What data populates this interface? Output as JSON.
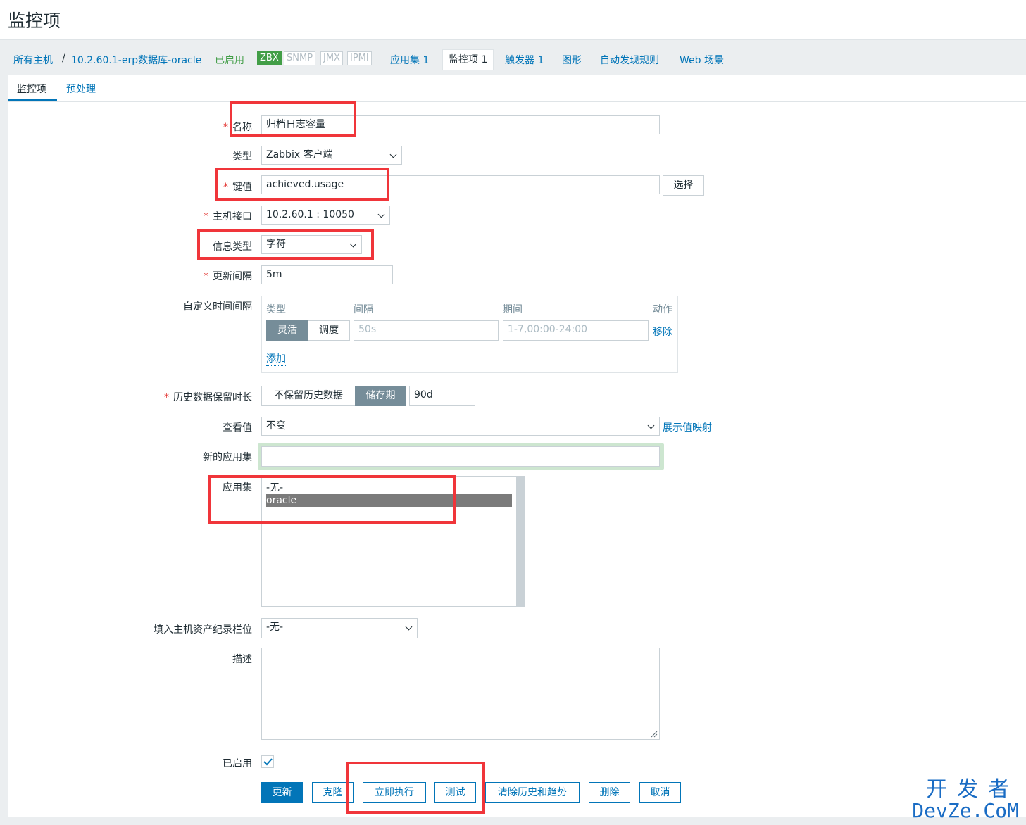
{
  "page_title": "监控项",
  "breadcrumb": {
    "all_hosts": "所有主机",
    "separator": "/",
    "host": "10.2.60.1-erp数据库-oracle",
    "status": "已启用",
    "protocols": [
      "ZBX",
      "SNMP",
      "JMX",
      "IPMI"
    ],
    "links": [
      "应用集 1",
      "监控项 1",
      "触发器 1",
      "图形",
      "自动发现规则",
      "Web 场景"
    ]
  },
  "tabs": [
    "监控项",
    "预处理"
  ],
  "form": {
    "name_label": "名称",
    "name_value": "归档日志容量",
    "type_label": "类型",
    "type_value": "Zabbix 客户端",
    "key_label": "键值",
    "key_value": "achieved.usage",
    "select_label": "选择",
    "interface_label": "主机接口",
    "interface_value": "10.2.60.1 : 10050",
    "info_type_label": "信息类型",
    "info_type_value": "字符",
    "update_label": "更新间隔",
    "update_value": "5m",
    "custom_label": "自定义时间间隔",
    "custom": {
      "col_type": "类型",
      "col_interval": "间隔",
      "col_period": "期间",
      "col_action": "动作",
      "flexible": "灵活",
      "scheduling": "调度",
      "interval_placeholder": "50s",
      "period_placeholder": "1-7,00:00-24:00",
      "remove": "移除",
      "add": "添加"
    },
    "history_label": "历史数据保留时长",
    "history_no_keep": "不保留历史数据",
    "history_storage": "储存期",
    "history_value": "90d",
    "show_value_label": "查看值",
    "show_value_value": "不变",
    "show_value_mapping": "展示值映射",
    "new_app_label": "新的应用集",
    "new_app_value": "",
    "apps_label": "应用集",
    "apps_options": [
      "-无-",
      "oracle"
    ],
    "inventory_label": "填入主机资产纪录栏位",
    "inventory_value": "-无-",
    "desc_label": "描述",
    "desc_value": "",
    "enabled_label": "已启用"
  },
  "buttons": {
    "update": "更新",
    "clone": "克隆",
    "execute_now": "立即执行",
    "test": "测试",
    "clear": "清除历史和趋势",
    "delete": "删除",
    "cancel": "取消"
  },
  "watermark": {
    "cn": "开发者",
    "en": "DevZe.CoM"
  }
}
